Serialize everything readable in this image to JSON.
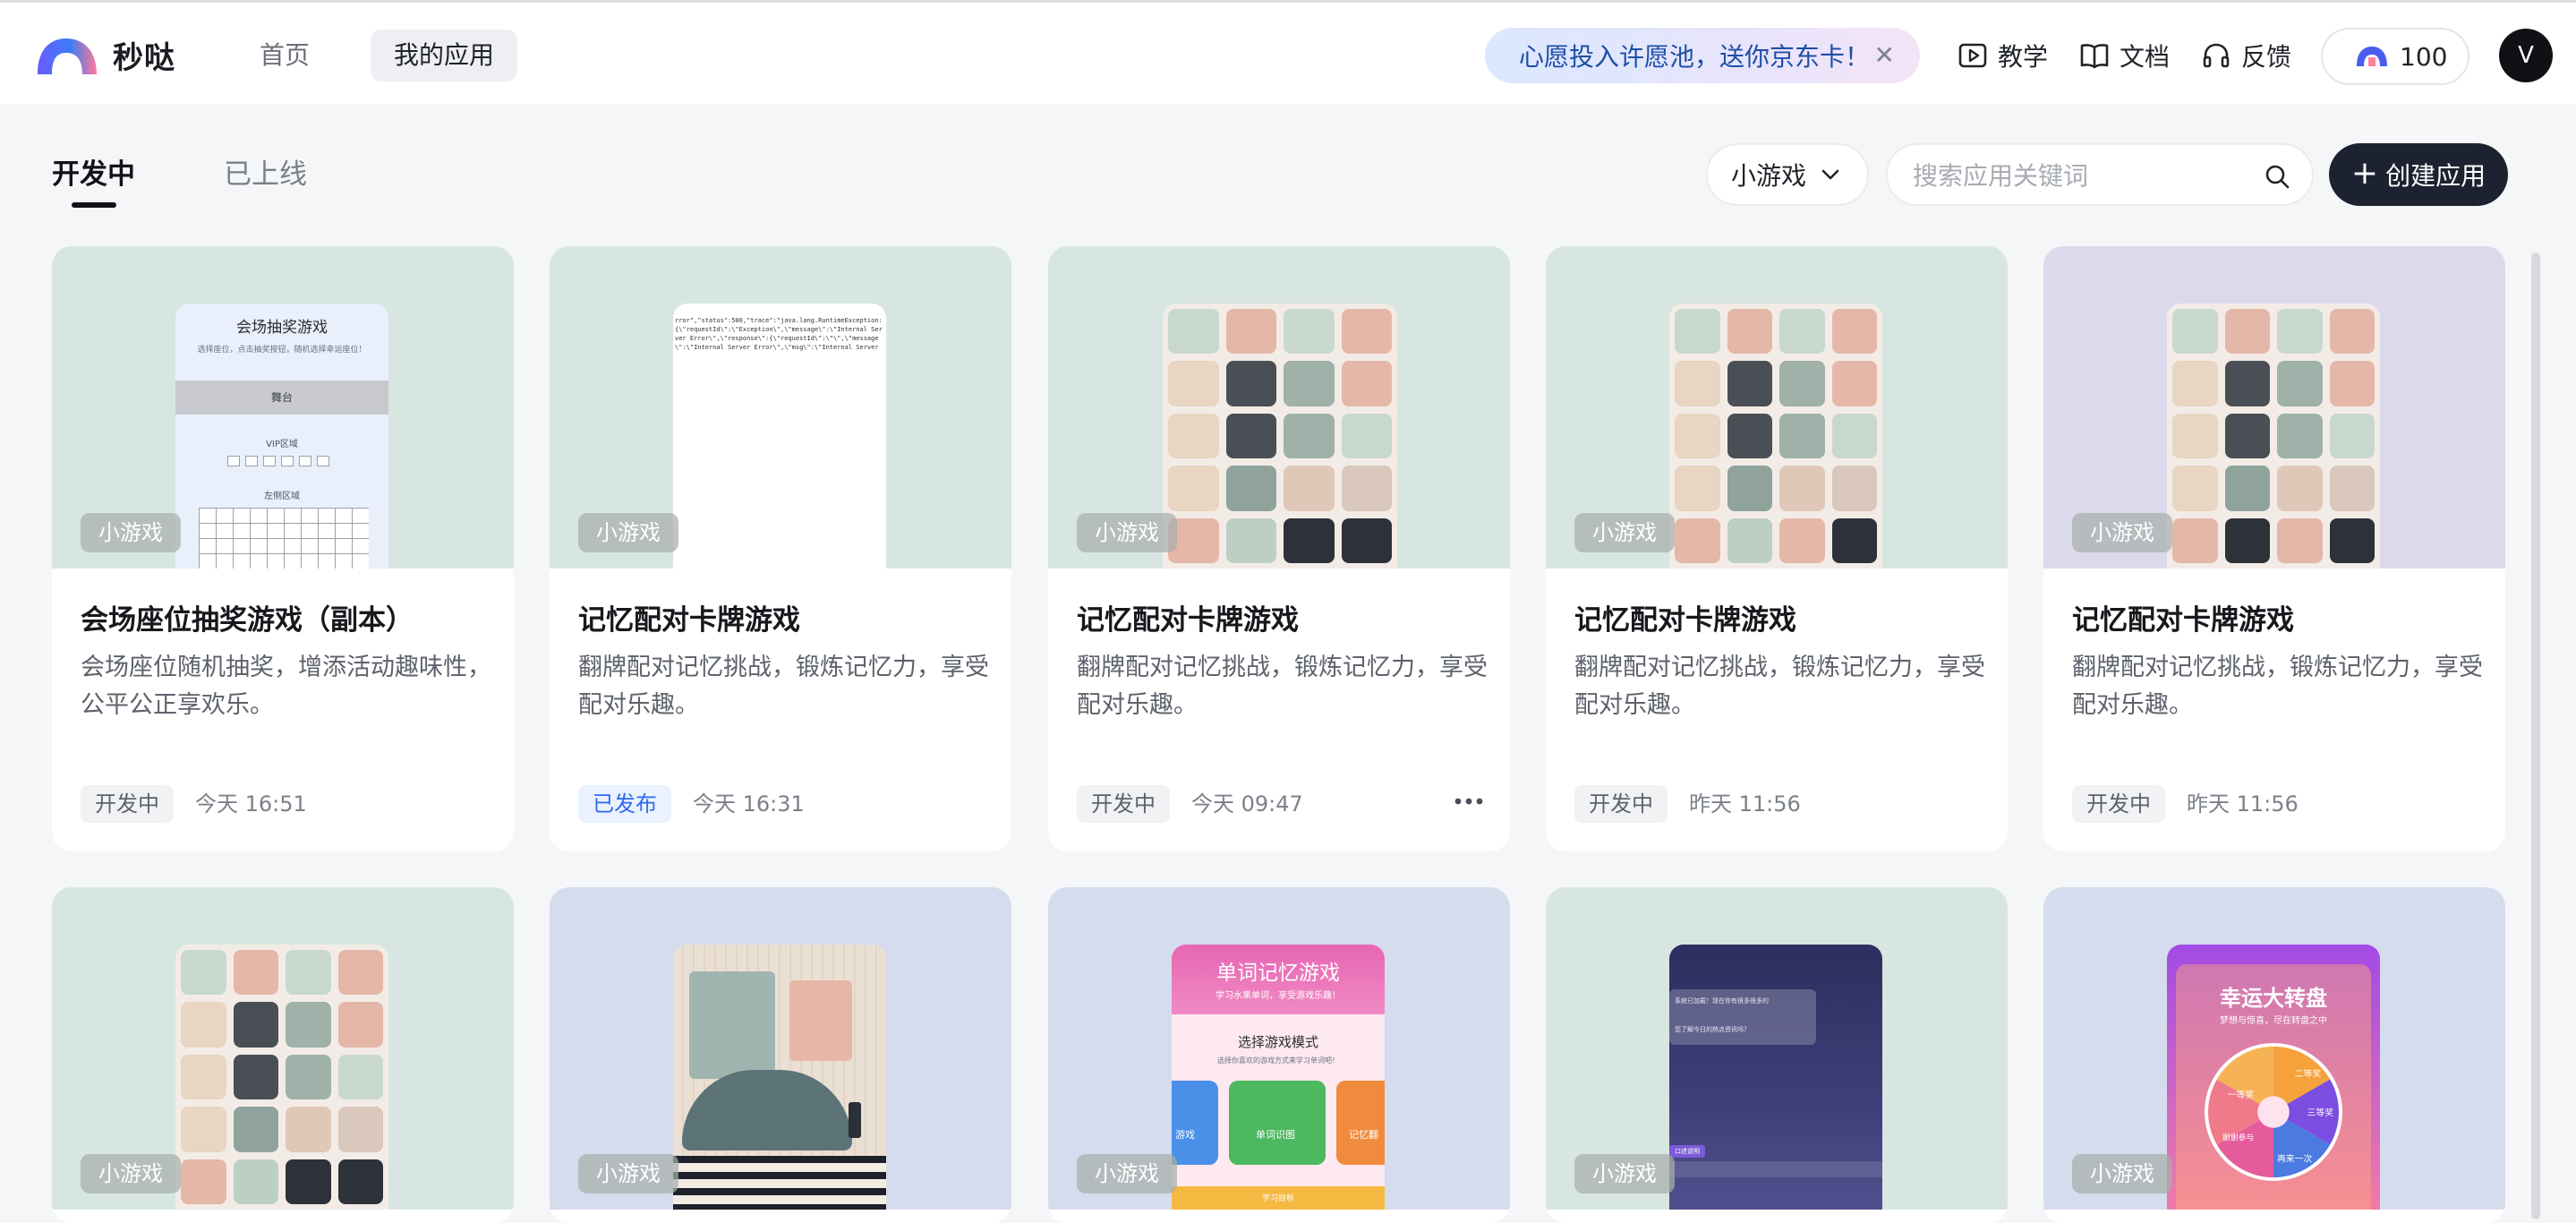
{
  "header": {
    "brand": "秒哒",
    "nav": {
      "home": "首页",
      "my_apps": "我的应用"
    },
    "promo": {
      "text": "心愿投入许愿池，送你京东卡！",
      "close_icon": "close-icon"
    },
    "links": {
      "tutorial": "教学",
      "docs": "文档",
      "feedback": "反馈"
    },
    "credits": "100",
    "avatar_initial": "V"
  },
  "toolbar": {
    "tabs": {
      "developing": "开发中",
      "online": "已上线"
    },
    "filter_value": "小游戏",
    "search_placeholder": "搜索应用关键词",
    "create_label": "创建应用"
  },
  "cards": [
    {
      "tag": "小游戏",
      "title": "会场座位抽奖游戏（副本）",
      "desc": "会场座位随机抽奖，增添活动趣味性，公平公正享欢乐。",
      "status": "开发中",
      "time": "今天 16:51",
      "bg": "#d7e6e0",
      "preview": {
        "title": "会场抽奖游戏",
        "subtitle": "选择座位，点击抽奖按钮，随机选择幸运座位！",
        "stage": "舞台",
        "vip": "VIP区域",
        "left": "左侧区域"
      }
    },
    {
      "tag": "小游戏",
      "title": "记忆配对卡牌游戏",
      "desc": "翻牌配对记忆挑战，锻炼记忆力，享受配对乐趣。",
      "status": "已发布",
      "time": "今天 16:31",
      "bg": "#d7e6e0",
      "preview": {
        "code": "rror\",\"status\":500,\"trace\":\"java.lang.RuntimeException: {\\\"requestId\\\":\\\"Exception\\\",\\\"message\\\":\\\"Internal Server Error\\\",\\\"response\\\":{\\\"requestId\\\":\\\"\\\",\\\"message\\\":\\\"Internal Server Error\\\",\\\"msg\\\":\\\"Internal Server Error\\\"}"
      }
    },
    {
      "tag": "小游戏",
      "title": "记忆配对卡牌游戏",
      "desc": "翻牌配对记忆挑战，锻炼记忆力，享受配对乐趣。",
      "status": "开发中",
      "time": "今天 09:47",
      "bg": "#d7e6e0"
    },
    {
      "tag": "小游戏",
      "title": "记忆配对卡牌游戏",
      "desc": "翻牌配对记忆挑战，锻炼记忆力，享受配对乐趣。",
      "status": "开发中",
      "time": "昨天 11:56",
      "bg": "#d7e6e0"
    },
    {
      "tag": "小游戏",
      "title": "记忆配对卡牌游戏",
      "desc": "翻牌配对记忆挑战，锻炼记忆力，享受配对乐趣。",
      "status": "开发中",
      "time": "昨天 11:56",
      "bg": "#dcd9ec"
    },
    {
      "tag": "小游戏",
      "bg": "#d7e6e0"
    },
    {
      "tag": "小游戏",
      "bg": "#d4dced"
    },
    {
      "tag": "小游戏",
      "bg": "#d4dced",
      "preview": {
        "title": "单词记忆游戏",
        "subtitle": "学习水果单词，享受游戏乐趣！",
        "mode": "选择游戏模式",
        "mode_hint": "选择你喜欢的游戏方式来学习单词吧！",
        "opt1": "游戏",
        "opt2": "单词识图",
        "opt3": "记忆翻",
        "footer": "学习目标"
      }
    },
    {
      "tag": "小游戏",
      "bg": "#d7e6e0",
      "preview": {
        "text1": "系统已加载！现在你有很多很多的",
        "text2": "您了解今日的热点资讯吗？",
        "badge": "口述说明"
      }
    },
    {
      "tag": "小游戏",
      "bg": "#d4dced",
      "preview": {
        "title": "幸运大转盘",
        "subtitle": "梦想与惊喜，尽在转盘之中",
        "s1": "一等奖",
        "s2": "二等奖",
        "s3": "三等奖",
        "s4": "谢谢参与",
        "s5": "再来一次"
      }
    }
  ],
  "colors": {
    "accent": "#2f6af0",
    "dark_button": "#1c2230",
    "brand_blue": "#3b5bdb",
    "brand_pink": "#e85a8c"
  }
}
